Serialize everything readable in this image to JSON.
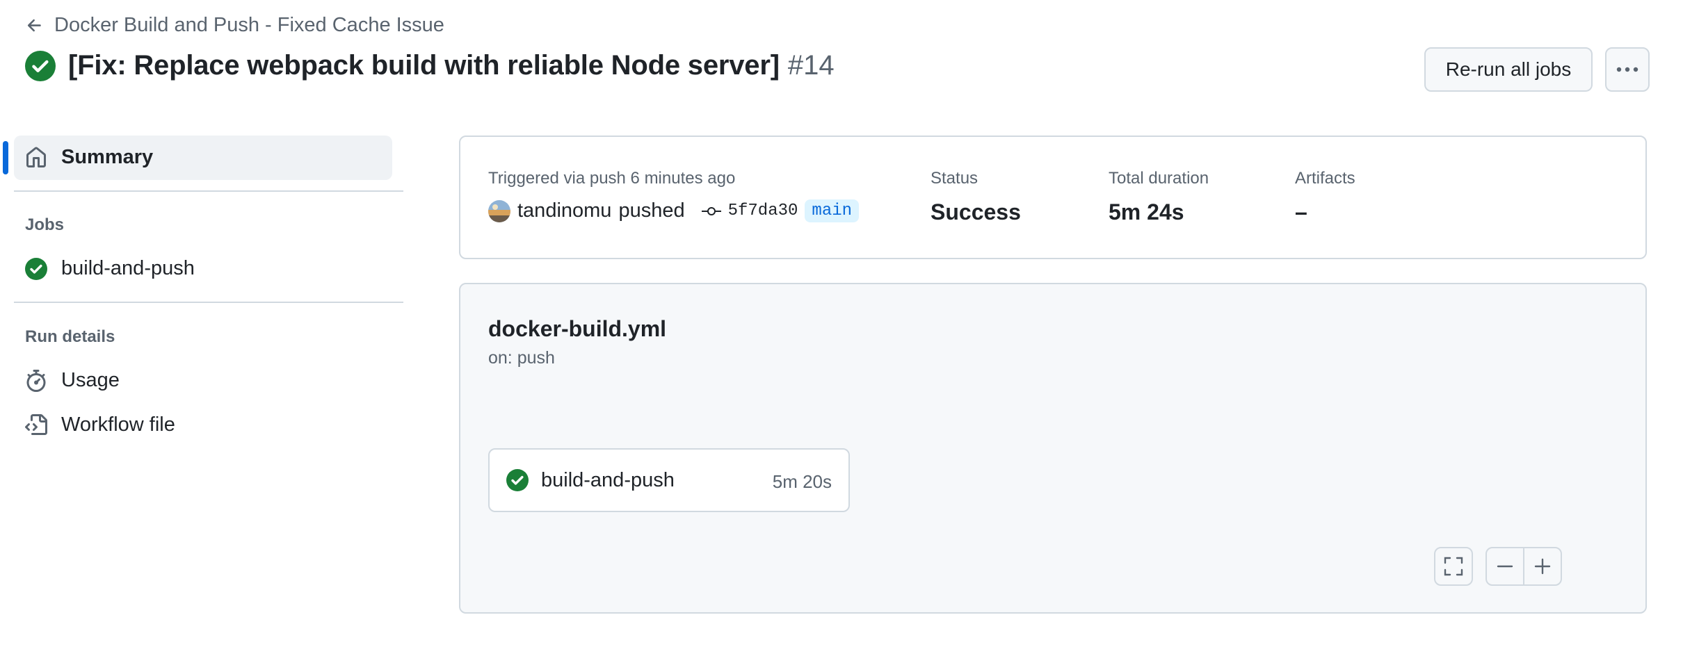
{
  "header": {
    "workflow_name": "Docker Build and Push - Fixed Cache Issue",
    "run_title": "[Fix: Replace webpack build with reliable Node server]",
    "run_number": "#14",
    "rerun_label": "Re-run all jobs",
    "more_label": "···"
  },
  "sidebar": {
    "summary_label": "Summary",
    "jobs_heading": "Jobs",
    "jobs": [
      {
        "label": "build-and-push",
        "status": "success"
      }
    ],
    "run_details_heading": "Run details",
    "run_details": [
      {
        "label": "Usage",
        "icon": "stopwatch-icon"
      },
      {
        "label": "Workflow file",
        "icon": "file-code-icon"
      }
    ]
  },
  "summary": {
    "trigger_text": "Triggered via push 6 minutes ago",
    "actor": "tandinomu",
    "action": "pushed",
    "commit": "5f7da30",
    "branch": "main",
    "status_label": "Status",
    "status_value": "Success",
    "duration_label": "Total duration",
    "duration_value": "5m 24s",
    "artifacts_label": "Artifacts",
    "artifacts_value": "–"
  },
  "workflow": {
    "file": "docker-build.yml",
    "trigger": "on: push",
    "job": {
      "label": "build-and-push",
      "duration": "5m 20s",
      "status": "success"
    }
  },
  "colors": {
    "success": "#1a7f37",
    "accent": "#0969da",
    "border": "#d1d9e0",
    "muted_text": "#59636e"
  }
}
